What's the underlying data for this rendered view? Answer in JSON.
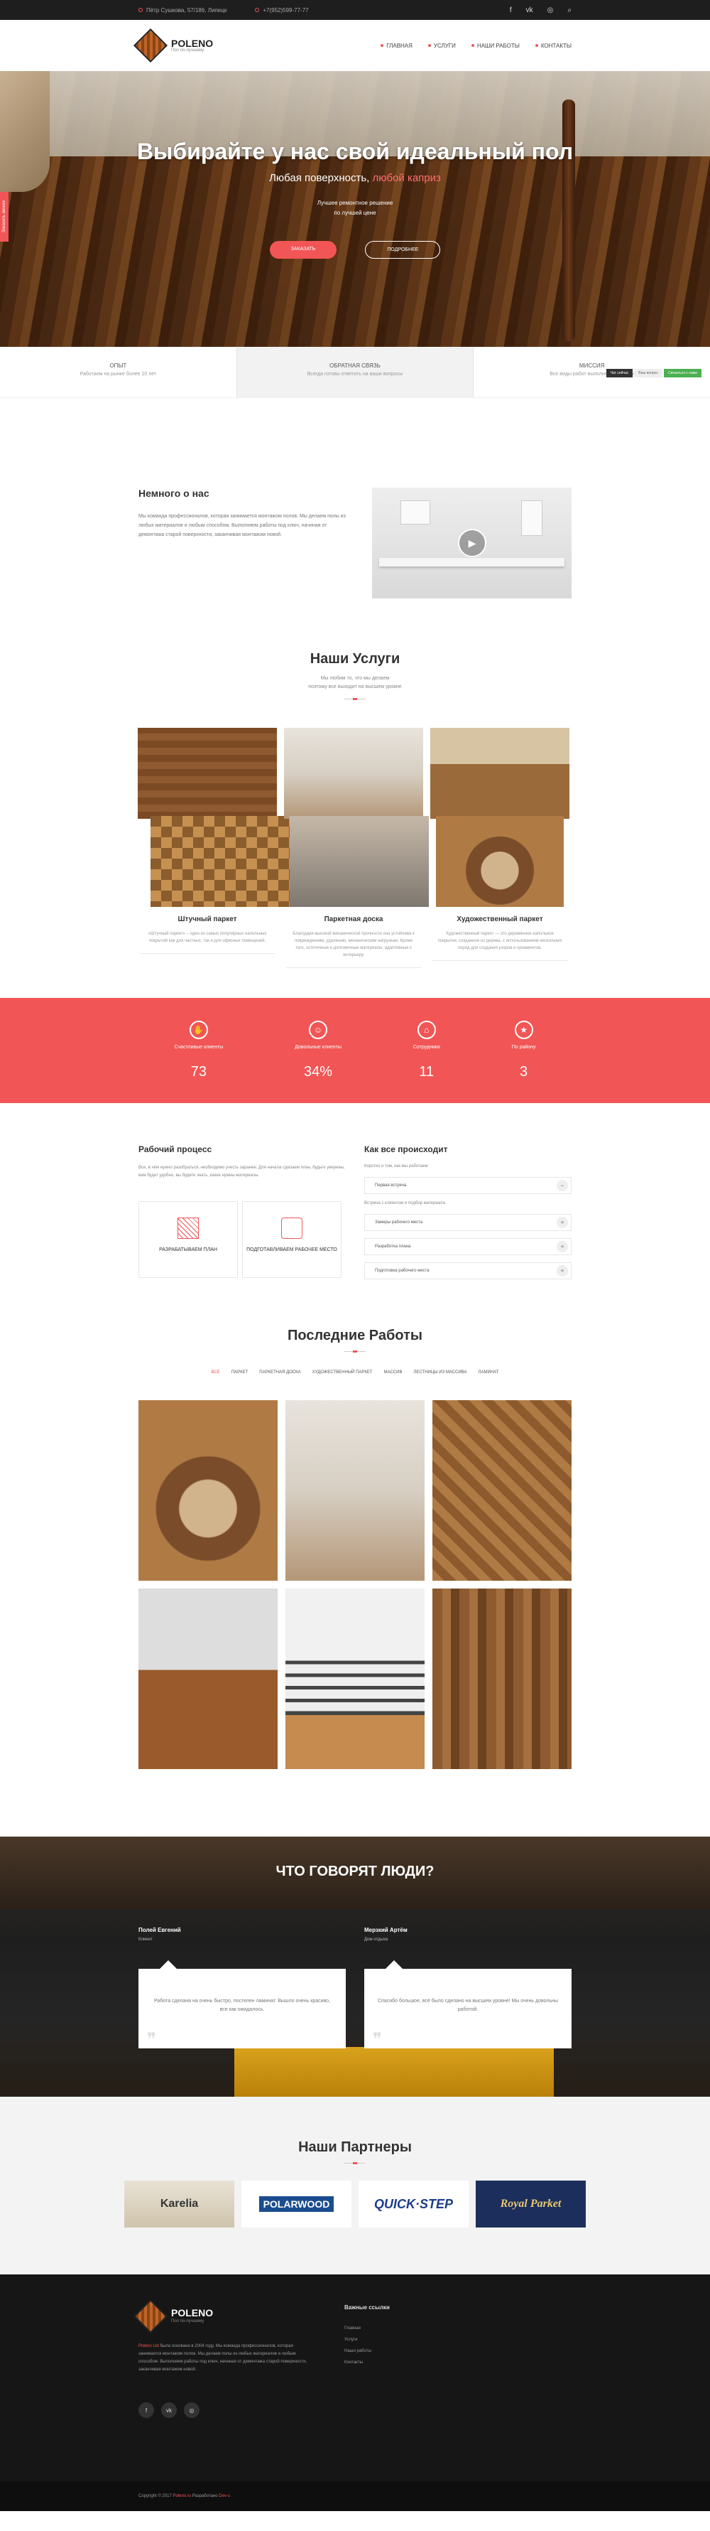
{
  "topbar": {
    "address": "Пётр Сушкова, 57/186, Липецк",
    "phone": "+7(952)599-77-77",
    "social": [
      "f",
      "vk",
      "in",
      "search"
    ]
  },
  "header": {
    "logo_title": "POLENO",
    "logo_sub": "Пол по-лучшему",
    "nav": [
      "ГЛАВНАЯ",
      "УСЛУГИ",
      "НАШИ РАБОТЫ",
      "КОНТАКТЫ"
    ]
  },
  "hero": {
    "title": "Выбирайте у нас свой идеальный пол",
    "sub_plain": "Любая поверхность,",
    "sub_accent": "любой каприз",
    "small_1": "Лучшее ремонтное решение",
    "small_2": "по лучшей цене",
    "btn_primary": "ЗАКАЗАТЬ",
    "btn_secondary": "ПОДРОБНЕЕ",
    "side_tab": "Заказать звонок"
  },
  "strip": [
    {
      "title": "ОПЫТ",
      "text": "Работаем на рынке более 10 лет"
    },
    {
      "title": "ОБРАТНАЯ СВЯЗЬ",
      "text": "Всегда готовы ответить на ваши вопросы"
    },
    {
      "title": "МИССИЯ",
      "text": "Все виды работ выполняются в срок"
    }
  ],
  "chat": {
    "a": "Чат сейчас",
    "b": "Ваш вопрос",
    "c": "Связаться с нами"
  },
  "about": {
    "title": "Немного о нас",
    "text": "Мы команда профессионалов, которая занимается монтажом полов. Мы делаем полы из любых материалов и любым способом. Выполняем работы под ключ, начиная от демонтажа старой поверхности, заканчивая монтажом новой."
  },
  "services": {
    "title": "Наши Услуги",
    "sub_1": "Мы любим то, что мы делаем",
    "sub_2": "поэтому все выходит на высшем уровне",
    "items": [
      {
        "title": "Штучный паркет",
        "text": "«Штучный паркет» – одно из самых популярных напольных покрытий как для частных, так и для офисных помещений."
      },
      {
        "title": "Паркетная доска",
        "text": "Благодаря высокой механической прочности она устойчива к повреждениям, удалению, механическим нагрузкам. Кроме того, эстетичные и долговечные материалы, адаптивные к интерьеру."
      },
      {
        "title": "Художественный паркет",
        "text": "Художественный паркет — это деревянное напольное покрытие, созданное из дерева, с использованием нескольких пород для создания узоров и орнаментов."
      }
    ]
  },
  "stats": [
    {
      "label": "Счастливые клиенты",
      "value": "73",
      "icon": "handshake-icon"
    },
    {
      "label": "Довольные клиенты",
      "value": "34%",
      "icon": "people-icon"
    },
    {
      "label": "Сотрудники",
      "value": "11",
      "icon": "building-icon"
    },
    {
      "label": "По району",
      "value": "3",
      "icon": "award-icon"
    }
  ],
  "process": {
    "title": "Рабочий процесс",
    "text": "Все, в чём нужно разобраться, необходимо учесть заранее. Для начала сделаем план, будьте уверены, вам будет удобно, вы будете знать, какие нужны материалы.",
    "steps": [
      "РАЗРАБАТЫВАЕМ ПЛАН",
      "ПОДГОТАВЛИВАЕМ РАБОЧЕЕ МЕСТО"
    ],
    "how_title": "Как все происходит",
    "how_text_1": "Коротко о том, как мы работаем",
    "acc": [
      "Первая встреча",
      "Замеры рабочего места",
      "Разработка плана",
      "Подготовка рабочего места"
    ],
    "how_text_2": "Встреча с клиентом и подбор материала"
  },
  "portfolio": {
    "title": "Последние Работы",
    "filters": [
      "ВСЕ",
      "ПАРКЕТ",
      "ПАРКЕТНАЯ ДОСКА",
      "ХУДОЖЕСТВЕННЫЙ ПАРКЕТ",
      "МАССИВ",
      "ЛЕСТНИЦЫ ИЗ МАССИВА",
      "ЛАМИНАТ"
    ]
  },
  "testimonials": {
    "title": "ЧТО ГОВОРЯТ ЛЮДИ?",
    "items": [
      {
        "name": "Полей Евгений",
        "role": "Клиент",
        "text": "Работа сделана на очень быстро, постелен ламинат. Вышло очень красиво, все как ожидалось."
      },
      {
        "name": "Мерзкий Артём",
        "role": "Дом отдыха",
        "text": "Спасибо большое, всё было сделано на высшем уровне! Мы очень довольны работой."
      }
    ]
  },
  "partners": {
    "title": "Наши Партнеры",
    "logos": [
      "Karelia",
      "POLARWOOD",
      "QUICK·STEP",
      "Royal Parket"
    ]
  },
  "footer": {
    "logo_title": "POLENO",
    "logo_sub": "Пол по-лучшему",
    "text_accent": "Poleno Ltd",
    "text": " была основана в 2004 году. Мы команда профессионалов, которая занимается монтажом полов. Мы делаем полы из любых материалов и любым способом. Выполняем работы под ключ, начиная от демонтажа старой поверхности, заканчивая монтажом новой.",
    "links_title": "Важные ссылки",
    "links": [
      "Главная",
      "Услуги",
      "Наши работы",
      "Контакты"
    ],
    "social": [
      "f",
      "vk",
      "in"
    ],
    "copy_plain": "Copyright © 2017",
    "copy_accent": "Poleno.ru",
    "copy_mid": " Разработано ",
    "copy_author": "Dev-s"
  }
}
